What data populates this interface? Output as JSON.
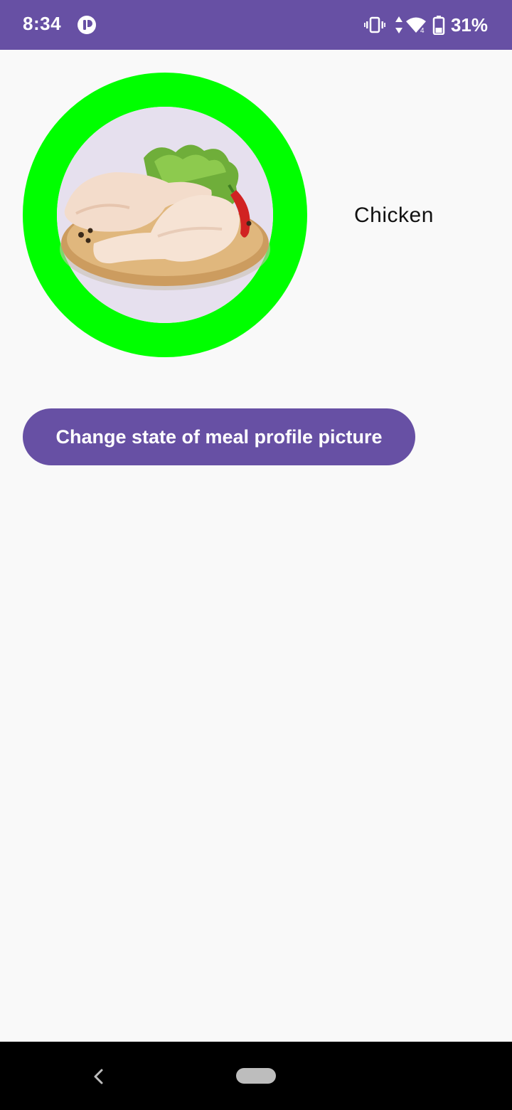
{
  "status_bar": {
    "time": "8:34",
    "battery_percent": "31%",
    "icons": [
      "app-notification-icon",
      "vibrate-icon",
      "data-transfer-icon",
      "wifi-icon",
      "battery-icon"
    ],
    "background_color": "#6750a4"
  },
  "meal": {
    "name": "Chicken",
    "image_description_icon": "chicken-plate-image",
    "ring_color": "#00ff00"
  },
  "actions": {
    "change_state_label": "Change state of meal profile picture",
    "button_color": "#6750a4"
  },
  "nav_bar": {
    "icons": [
      "back-icon",
      "home-pill"
    ]
  }
}
